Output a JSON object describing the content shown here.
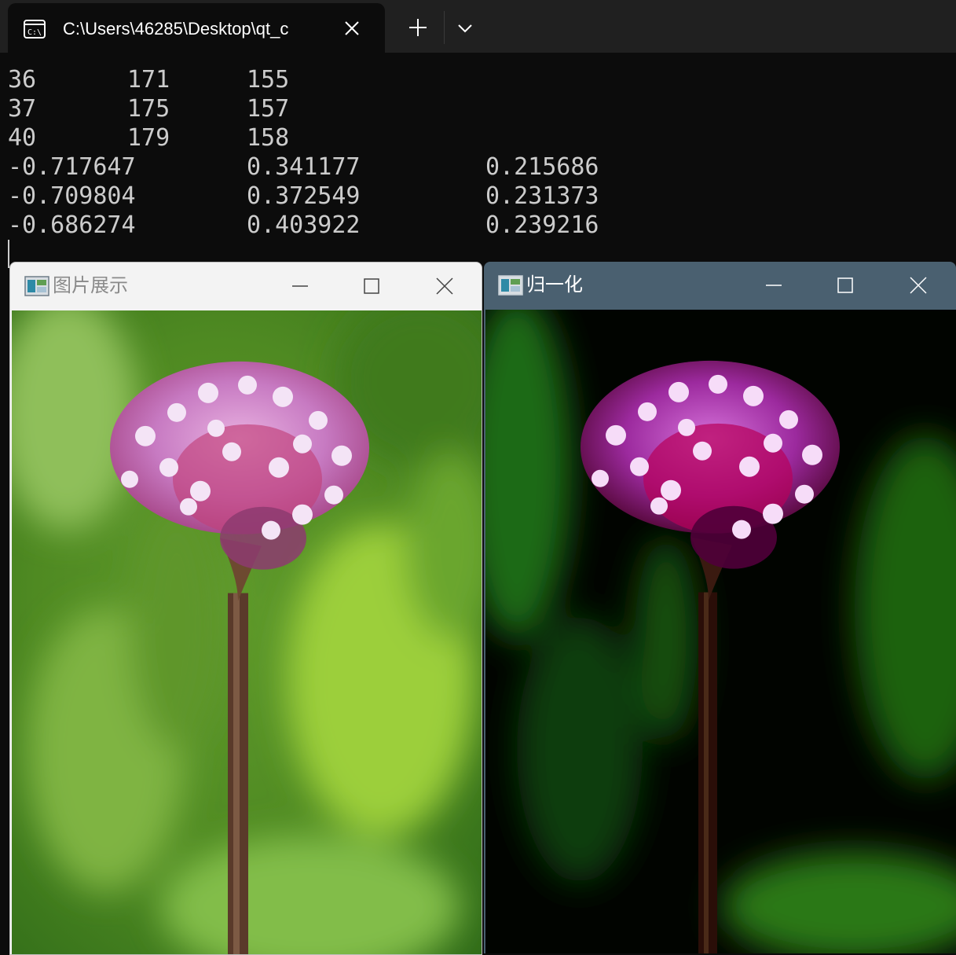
{
  "terminal": {
    "tab_title": "C:\\Users\\46285\\Desktop\\qt_c",
    "lines": [
      [
        "36",
        "171",
        "155"
      ],
      [
        "37",
        "175",
        "157"
      ],
      [
        "40",
        "179",
        "158"
      ],
      [
        "-0.717647",
        "0.341177",
        "0.215686"
      ],
      [
        "-0.709804",
        "0.372549",
        "0.231373"
      ],
      [
        "-0.686274",
        "0.403922",
        "0.239216"
      ]
    ],
    "icons": [
      "terminal-icon",
      "close-icon",
      "plus-icon",
      "chevron-down-icon"
    ]
  },
  "windows": [
    {
      "title": "图片展示",
      "image": "pink verbena flower on green blurred background",
      "icons": [
        "app-icon",
        "minimize-icon",
        "maximize-icon",
        "close-icon"
      ]
    },
    {
      "title": "归一化",
      "image": "normalized verbena flower, dark contrast",
      "icons": [
        "app-icon",
        "minimize-icon",
        "maximize-icon",
        "close-icon"
      ]
    }
  ],
  "colors": {
    "terminal_bg": "#0c0c0c",
    "terminal_text": "#cccccc",
    "tabbar_bg": "#202020",
    "active_titlebar": "#4a6070",
    "inactive_titlebar": "#f3f3f3"
  }
}
